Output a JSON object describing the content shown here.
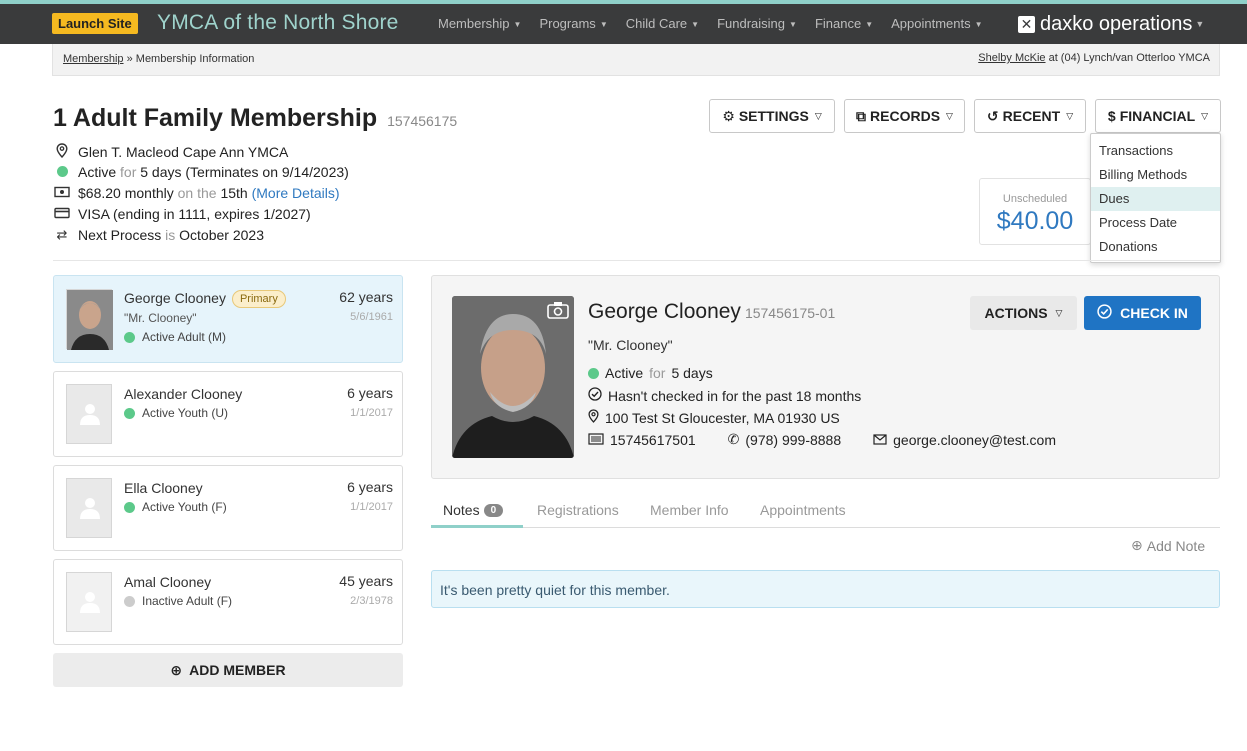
{
  "topbar": {
    "launch_label": "Launch Site",
    "site_name": "YMCA of the North Shore",
    "nav": [
      "Membership",
      "Programs",
      "Child Care",
      "Fundraising",
      "Finance",
      "Appointments"
    ],
    "brand": "daxko operations",
    "accent": "#8fd0c9"
  },
  "breadcrumb": {
    "root": "Membership",
    "separator": "»",
    "current": "Membership Information",
    "user_name": "Shelby McKie",
    "user_location": "at (04) Lynch/van Otterloo YMCA"
  },
  "membership": {
    "title": "1 Adult Family Membership",
    "number": "157456175",
    "branch": "Glen T. Macleod Cape Ann YMCA",
    "status": "Active",
    "status_for": "for",
    "status_days": "5 days (Terminates on 9/14/2023)",
    "amount": "$68.20 monthly",
    "on_the": "on the",
    "day": "15th",
    "more_details": "(More Details)",
    "card": "VISA (ending in 1111, expires 1/2027)",
    "next_label": "Next Process",
    "next_is": "is",
    "next_value": "October 2023"
  },
  "buttons": {
    "settings": "SETTINGS",
    "records": "RECORDS",
    "recent": "RECENT",
    "financial": "FINANCIAL"
  },
  "financial_menu": [
    "Transactions",
    "Billing Methods",
    "Dues",
    "Process Date",
    "Donations"
  ],
  "financial_menu_active": "Dues",
  "unscheduled": {
    "label": "Unscheduled",
    "amount": "$40.00"
  },
  "members": [
    {
      "name": "George Clooney",
      "badge": "Primary",
      "nickname": "\"Mr. Clooney\"",
      "status": "Active Adult (M)",
      "age": "62 years",
      "dob": "5/6/1961",
      "active": true
    },
    {
      "name": "Alexander Clooney",
      "status": "Active Youth (U)",
      "age": "6 years",
      "dob": "1/1/2017",
      "active": true
    },
    {
      "name": "Ella Clooney",
      "status": "Active Youth (F)",
      "age": "6 years",
      "dob": "1/1/2017",
      "active": true
    },
    {
      "name": "Amal Clooney",
      "status": "Inactive Adult (F)",
      "age": "45 years",
      "dob": "2/3/1978",
      "active": false
    }
  ],
  "add_member": "ADD MEMBER",
  "detail": {
    "name": "George Clooney",
    "number": "157456175-01",
    "nickname": "\"Mr. Clooney\"",
    "status": "Active",
    "status_for": "for",
    "status_days": "5 days",
    "checkin_note": "Hasn't checked in for the past 18 months",
    "address": "100 Test St Gloucester, MA 01930 US",
    "barcode": "15745617501",
    "phone": "(978) 999-8888",
    "email": "george.clooney@test.com",
    "actions": "ACTIONS",
    "check_in": "CHECK IN"
  },
  "tabs": {
    "notes": "Notes",
    "notes_count": "0",
    "registrations": "Registrations",
    "member_info": "Member Info",
    "appointments": "Appointments"
  },
  "add_note": "Add Note",
  "empty_message": "It's been pretty quiet for this member."
}
